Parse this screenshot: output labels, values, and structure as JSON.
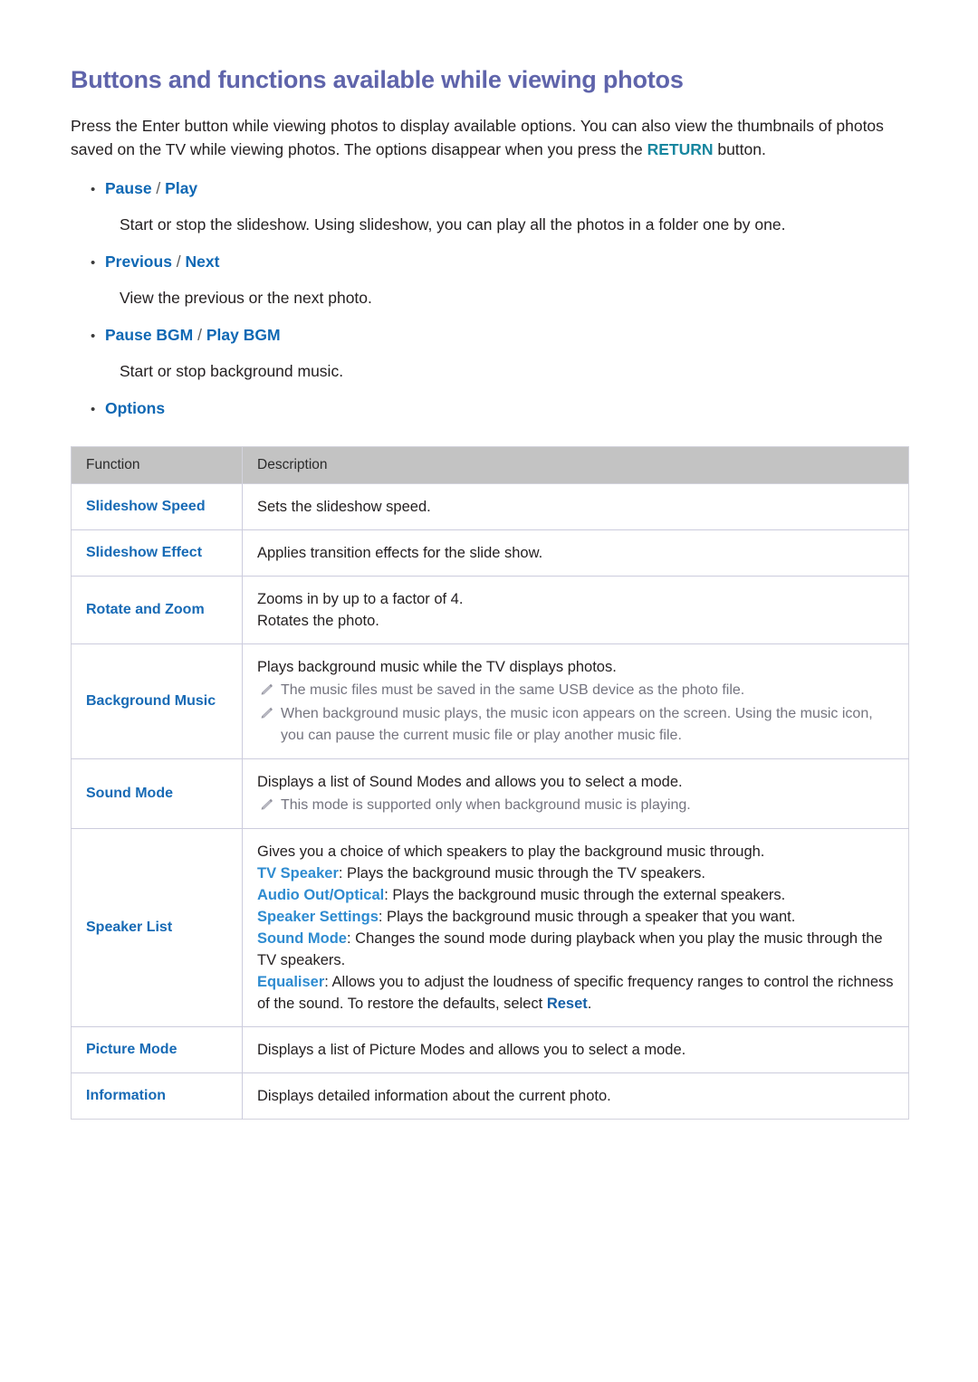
{
  "page": {
    "title": "Buttons and functions available while viewing photos",
    "intro": {
      "part1": "Press the Enter button while viewing photos to display available options. You can also view the thumbnails of photos saved on the TV while viewing photos. The options disappear when you press the ",
      "keyword": "RETURN",
      "part2": " button."
    }
  },
  "bullets": [
    {
      "marker": "•",
      "label_a": "Pause",
      "separator": " / ",
      "label_b": "Play",
      "description": "Start or stop the slideshow. Using slideshow, you can play all the photos in a folder one by one."
    },
    {
      "marker": "•",
      "label_a": "Previous",
      "separator": " / ",
      "label_b": "Next",
      "description": "View the previous or the next photo."
    },
    {
      "marker": "•",
      "label_a": "Pause BGM",
      "separator": " / ",
      "label_b": "Play BGM",
      "description": "Start or stop background music."
    },
    {
      "marker": "•",
      "label_a": "Options",
      "separator": "",
      "label_b": "",
      "description": ""
    }
  ],
  "table": {
    "headers": {
      "function": "Function",
      "description": "Description"
    },
    "rows": [
      {
        "function": "Slideshow Speed",
        "lines": [
          "Sets the slideshow speed."
        ],
        "notes": []
      },
      {
        "function": "Slideshow Effect",
        "lines": [
          "Applies transition effects for the slide show."
        ],
        "notes": []
      },
      {
        "function": "Rotate and Zoom",
        "lines": [
          "Zooms in by up to a factor of 4.",
          "Rotates the photo."
        ],
        "notes": []
      },
      {
        "function": "Background Music",
        "lines": [
          "Plays background music while the TV displays photos."
        ],
        "notes": [
          "The music files must be saved in the same USB device as the photo file.",
          "When background music plays, the music icon appears on the screen. Using the music icon, you can pause the current music file or play another music file."
        ]
      },
      {
        "function": "Sound Mode",
        "lines": [
          "Displays a list of Sound Modes and allows you to select a mode."
        ],
        "notes": [
          "This mode is supported only when background music is playing."
        ]
      },
      {
        "function": "Speaker List",
        "lines": [],
        "rich_lines": [
          {
            "kw": "",
            "kw_style": "",
            "text": "Gives you a choice of which speakers to play the background music through."
          },
          {
            "kw": "TV Speaker",
            "kw_style": "light",
            "text": ": Plays the background music through the TV speakers."
          },
          {
            "kw": "Audio Out/Optical",
            "kw_style": "light",
            "text": ": Plays the background music through the external speakers."
          },
          {
            "kw": "Speaker Settings",
            "kw_style": "light",
            "text": ": Plays the background music through a speaker that you want."
          },
          {
            "kw": "Sound Mode",
            "kw_style": "light",
            "text": ": Changes the sound mode during playback when you play the music through the TV speakers."
          },
          {
            "kw": "Equaliser",
            "kw_style": "light",
            "text": ": Allows you to adjust the loudness of specific frequency ranges to control the richness of the sound. To restore the defaults, select ",
            "kw_tail": "Reset",
            "kw_tail_style": "dark",
            "tail_text": "."
          }
        ],
        "notes": []
      },
      {
        "function": "Picture Mode",
        "lines": [
          "Displays a list of Picture Modes and allows you to select a mode."
        ],
        "notes": []
      },
      {
        "function": "Information",
        "lines": [
          "Displays detailed information about the current photo."
        ],
        "notes": []
      }
    ]
  },
  "icons": {
    "note": "pencil-icon",
    "bullet": "bullet-dot-icon"
  },
  "colors": {
    "title": "#5f64ab",
    "link_blue": "#0f68b4",
    "table_link_blue": "#176ab5",
    "inline_light_blue": "#2e8bd0",
    "inline_dark_blue": "#1560a8",
    "teal_keyword": "#17869f",
    "note_gray": "#74747f",
    "header_bg": "#c3c3c3",
    "border": "#ccccdd",
    "page_bg": "#ffffff"
  }
}
